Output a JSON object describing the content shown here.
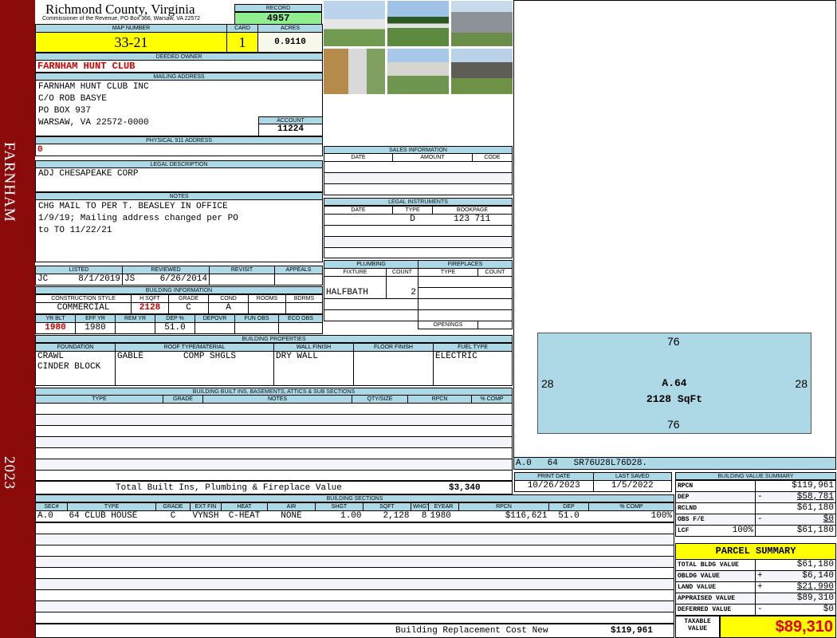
{
  "sidebar": {
    "district": "FARNHAM",
    "year": "2023"
  },
  "header": {
    "county": "Richmond County, Virginia",
    "office": "Commissioner of the Revenue, PO Box 366, Warsaw, VA 22572",
    "record_label": "RECORD",
    "record": "4957"
  },
  "parcel": {
    "map_label": "MAP NUMBER",
    "map": "33-21",
    "card_label": "CARD",
    "card": "1",
    "acres_label": "ACRES",
    "acres": "0.9110"
  },
  "owner": {
    "label": "DEEDED OWNER",
    "name": "FARNHAM HUNT CLUB"
  },
  "mailing": {
    "label": "MAILING ADDRESS",
    "lines": [
      "FARNHAM HUNT CLUB INC",
      "C/O ROB BASYE",
      "PO BOX 937",
      "WARSAW, VA 22572-0000"
    ],
    "account_label": "ACCOUNT",
    "account": "11224"
  },
  "physical": {
    "label": "PHYSICAL 911 ADDRESS",
    "value": "0"
  },
  "legal": {
    "label": "LEGAL DESCRIPTION",
    "value": "ADJ CHESAPEAKE CORP"
  },
  "notes": {
    "label": "NOTES",
    "lines": [
      "CHG MAIL TO PER T. BEASLEY IN OFFICE",
      "1/9/19; Mailing address changed per PO",
      "to TO 11/22/21"
    ]
  },
  "review": {
    "headers": [
      "LISTED",
      "REVIEWED",
      "REVISIT",
      "APPEALS"
    ],
    "listed_by": "JC",
    "listed_date": "8/1/2019",
    "reviewed_by": "JS",
    "reviewed_date": "6/26/2014"
  },
  "building_info": {
    "label": "BUILDING INFORMATION",
    "headers1": [
      "CONSTRUCTION STYLE",
      "H SQFT",
      "GRADE",
      "COND",
      "ROOMS",
      "BDRMS"
    ],
    "values1": [
      "COMMERCIAL",
      "2128",
      "C",
      "A",
      "",
      ""
    ],
    "headers2": [
      "YR BLT",
      "EFF YR",
      "REM YR",
      "DEP %",
      "DEPOVR",
      "FUN OBS",
      "ECO OBS"
    ],
    "values2": [
      "1980",
      "1980",
      "",
      "51.0",
      "",
      "",
      ""
    ]
  },
  "properties": {
    "label": "BUILDING PROPERTIES",
    "headers": [
      "FOUNDATION",
      "ROOF TYPE/MATERIAL",
      "WALL FINISH",
      "FLOOR FINISH",
      "FUEL TYPE"
    ],
    "foundation": [
      "CRAWL",
      "CINDER BLOCK"
    ],
    "roof_type": "GABLE",
    "roof_material": "COMP SHGLS",
    "wall": "DRY WALL",
    "floor": "",
    "fuel": "ELECTRIC"
  },
  "builtins": {
    "label": "BUILDING BUILT INS, BASEMENTS, ATTICS & SUB SECTIONS",
    "headers": [
      "TYPE",
      "GRADE",
      "NOTES",
      "QTY/SIZE",
      "RPCN",
      "% COMP"
    ],
    "total_label": "Total Built Ins, Plumbing & Fireplace Value",
    "total": "$3,340"
  },
  "sales": {
    "label": "SALES INFORMATION",
    "headers": [
      "DATE",
      "AMOUNT",
      "CODE"
    ]
  },
  "instruments": {
    "label": "LEGAL INSTRUMENTS",
    "headers": [
      "DATE",
      "TYPE",
      "BOOKPAGE"
    ],
    "rows": [
      {
        "date": "",
        "type": "D",
        "bookpage": "123 711"
      }
    ]
  },
  "plumbing": {
    "label": "PLUMBING",
    "headers": [
      "FIXTURE",
      "COUNT"
    ],
    "rows": [
      {
        "fixture": "HALFBATH",
        "count": "2"
      }
    ]
  },
  "fireplaces": {
    "label": "FIREPLACES",
    "headers": [
      "TYPE",
      "COUNT"
    ],
    "openings_label": "OPENINGS"
  },
  "sketch": {
    "top": "76",
    "bottom": "76",
    "left": "28",
    "right": "28",
    "section": "A.64",
    "area": "2128 SqFt",
    "vector": "A.0   64   SR76U28L76D28."
  },
  "dates": {
    "print_label": "PRINT DATE",
    "print": "10/26/2023",
    "saved_label": "LAST SAVED",
    "saved": "1/5/2022"
  },
  "sections": {
    "label": "BUILDING SECTIONS",
    "headers": [
      "SEC#",
      "TYPE",
      "GRADE",
      "EXT FIN",
      "HEAT",
      "AIR",
      "SHGT",
      "SQFT",
      "WHGT",
      "EYEAR",
      "RPCN",
      "DEP",
      "% COMP"
    ],
    "row": [
      "A.0",
      "64 CLUB HOUSE",
      "C",
      "VYNSH",
      "C-HEAT",
      "NONE",
      "1.00",
      "2,128",
      "8",
      "1980",
      "$116,621",
      "51.0",
      "100%"
    ],
    "rcn_label": "Building Replacement Cost New",
    "rcn": "$119,961"
  },
  "value_summary": {
    "label": "BUILDING VALUE SUMMARY",
    "rpcn_label": "RPCN",
    "rpcn": "$119,961",
    "dep_label": "DEP",
    "dep": "$58,781",
    "rclnd_label": "RCLND",
    "rclnd": "$61,180",
    "obs_label": "OBS F/E",
    "obs": "$0",
    "lcf_label": "LCF",
    "lcf_pct": "100%",
    "lcf": "$61,180",
    "minus": "-"
  },
  "parcel_summary": {
    "label": "PARCEL SUMMARY",
    "total_bldg_label": "TOTAL BLDG VALUE",
    "total_bldg": "$61,180",
    "obldg_label": "OBLDG VALUE",
    "obldg": "$6,140",
    "land_label": "LAND VALUE",
    "land": "$21,990",
    "appraised_label": "APPRAISED VALUE",
    "appraised": "$89,310",
    "deferred_label": "DEFERRED VALUE",
    "deferred": "$0",
    "taxable_label": "TAXABLE VALUE",
    "taxable": "$89,310",
    "plus": "+",
    "minus": "-"
  },
  "colors": {
    "sidebar": "#8b0a0a",
    "header": "#add8e6",
    "highlight": "#ffff00",
    "record": "#90ee90",
    "alert": "#d00000"
  }
}
